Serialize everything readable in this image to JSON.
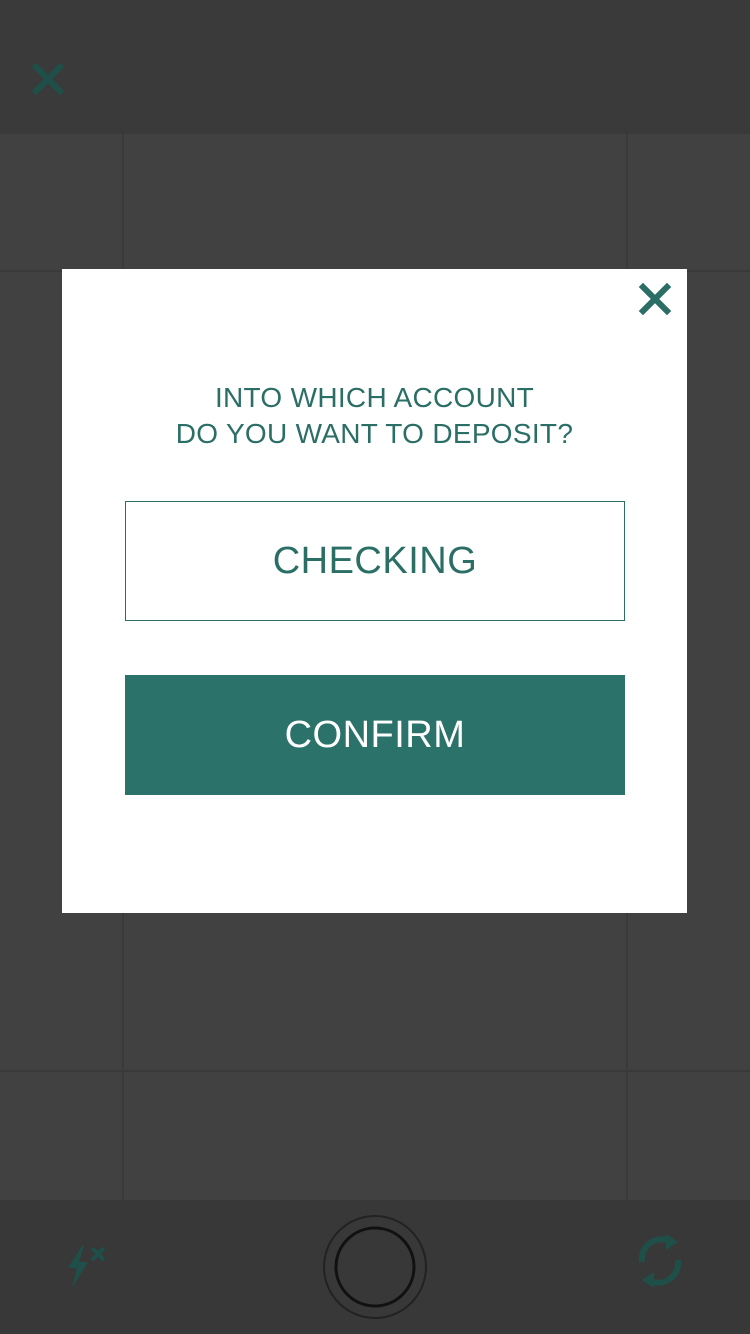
{
  "modal": {
    "title_line1": "INTO WHICH ACCOUNT",
    "title_line2": "DO YOU WANT TO DEPOSIT?",
    "account_selected": "CHECKING",
    "confirm_label": "CONFIRM"
  },
  "colors": {
    "accent": "#2a6e66",
    "confirm_bg": "#2a726a",
    "camera_bg": "#414141",
    "modal_bg": "#ffffff"
  },
  "icons": {
    "top_left": "close-icon",
    "modal_close": "close-icon",
    "bottom_left": "flash-off-icon",
    "bottom_center": "shutter-button",
    "bottom_right": "camera-flip-icon"
  }
}
